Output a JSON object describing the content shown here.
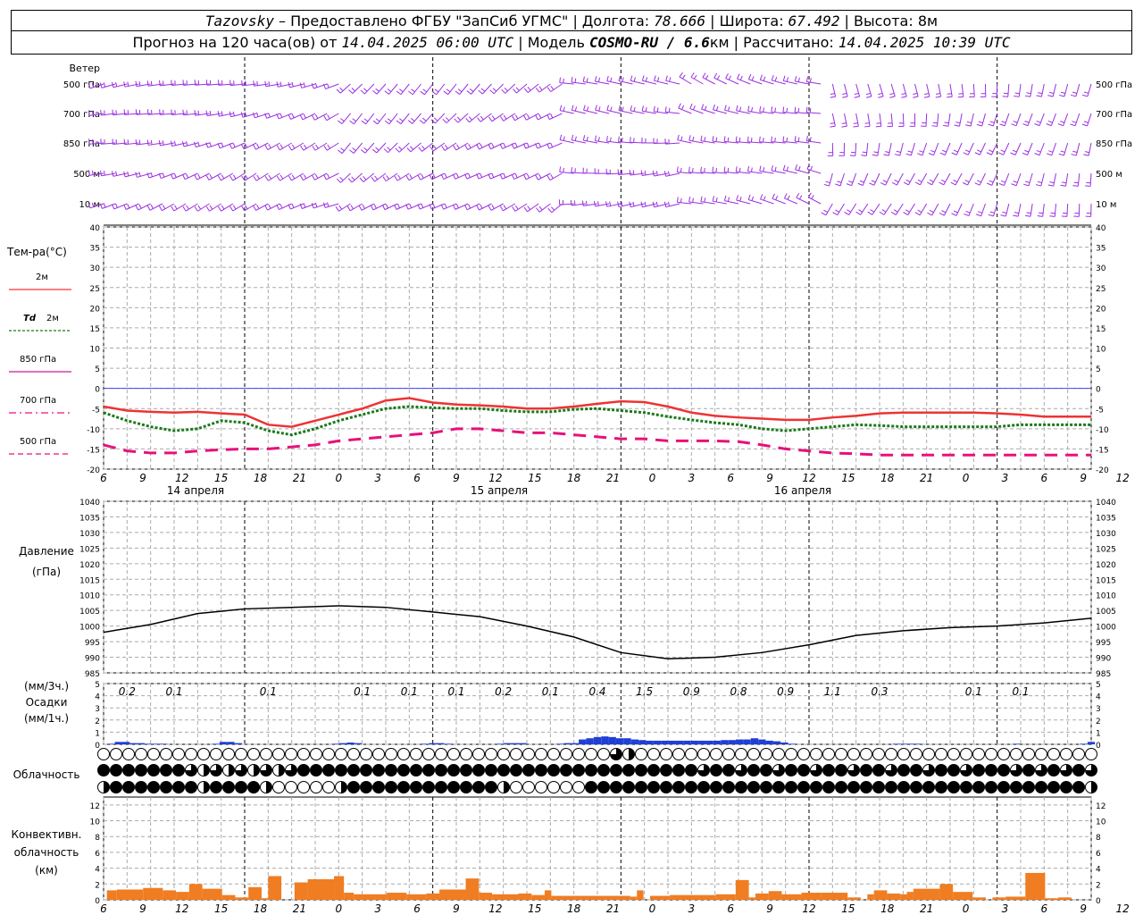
{
  "header": {
    "station": "Tazovsky",
    "provider": " – Предоставлено ФГБУ \"ЗапСиб УГМС\"",
    "lon_label": "Долгота:",
    "lon": "78.666",
    "lat_label": "Широта:",
    "lat": "67.492",
    "alt_label": "Высота:",
    "alt": "8м",
    "forecast_prefix": "Прогноз на 120 часа(ов) от",
    "forecast_start": "14.04.2025 06:00 UTC",
    "model_label": "Модель",
    "model": "COSMO-RU / 6.6",
    "model_unit": "км",
    "calc_label": "Рассчитано:",
    "calc_time": "14.04.2025 10:39 UTC"
  },
  "labels": {
    "wind": "Ветер",
    "wind_levels": [
      "500 гПа",
      "700 гПа",
      "850 гПа",
      "500 м",
      "10   м"
    ],
    "temp_title": "Тем-ра(°C)",
    "temp_legend": [
      {
        "prefix": "",
        "text": "2м",
        "color": "#ff3030",
        "dash": ""
      },
      {
        "prefix": "Td",
        "text": "2м",
        "color": "#1a7a1a",
        "dash": "3,2"
      },
      {
        "prefix": "",
        "text": "850 гПа",
        "color": "#cc1a9e",
        "dash": ""
      },
      {
        "prefix": "",
        "text": "700 гПа",
        "color": "#e8107a",
        "dash": "8,4,2,4"
      },
      {
        "prefix": "",
        "text": "500 гПа",
        "color": "#e8107a",
        "dash": "6,4"
      }
    ],
    "pressure_title": "Давление",
    "pressure_unit": "(гПа)",
    "precip_unit3": "(мм/3ч.)",
    "precip_title": "Осадки",
    "precip_unit1": "(мм/1ч.)",
    "cloud_title": "Облачность",
    "conv_title1": "Конвективн.",
    "conv_title2": "облачность",
    "conv_unit": "(км)"
  },
  "axis": {
    "hour_ticks": [
      "6",
      "9",
      "12",
      "15",
      "18",
      "21",
      "0",
      "3",
      "6",
      "9",
      "12",
      "15",
      "18",
      "21",
      "0",
      "3",
      "6",
      "9",
      "12",
      "15",
      "18",
      "21",
      "0",
      "3",
      "6",
      "9",
      "12"
    ],
    "days": [
      "14 апреля",
      "15 апреля",
      "16 апреля"
    ]
  },
  "chart_data": [
    {
      "type": "line",
      "name": "temperature",
      "x_hours_from_start": [
        0,
        3,
        6,
        9,
        12,
        15,
        18,
        21,
        24,
        27,
        30,
        33,
        36,
        39,
        42,
        45,
        48,
        51,
        54,
        57,
        60,
        63,
        66,
        69,
        72,
        75,
        78,
        81,
        84,
        87,
        90,
        93,
        96,
        99,
        102,
        105,
        108,
        111,
        114,
        117,
        120,
        123,
        126
      ],
      "ylim": [
        -20,
        40
      ],
      "yticks": [
        -20,
        -15,
        -10,
        -5,
        0,
        5,
        10,
        15,
        20,
        25,
        30,
        35,
        40
      ],
      "series": [
        {
          "name": "2м",
          "values": [
            -4.5,
            -5.5,
            -5.8,
            -6,
            -5.8,
            -6.2,
            -6.5,
            -9,
            -9.5,
            -8,
            -6.5,
            -5,
            -3,
            -2.4,
            -3.5,
            -4,
            -4.2,
            -4.5,
            -5,
            -5,
            -4.5,
            -3.8,
            -3.2,
            -3.4,
            -4.5,
            -6,
            -6.8,
            -7.2,
            -7.5,
            -7.8,
            -7.8,
            -7.2,
            -6.8,
            -6.2,
            -6.0,
            -6.0,
            -6.0,
            -6.0,
            -6.2,
            -6.5,
            -7,
            -7,
            -7
          ]
        },
        {
          "name": "Td 2м",
          "values": [
            -6,
            -8,
            -9.5,
            -10.5,
            -10,
            -8,
            -8.5,
            -10.5,
            -11.5,
            -10,
            -8,
            -6.5,
            -5,
            -4.5,
            -4.8,
            -5,
            -5,
            -5.5,
            -5.8,
            -5.8,
            -5.2,
            -5,
            -5.5,
            -6,
            -7,
            -7.8,
            -8.5,
            -9,
            -10,
            -10.5,
            -10,
            -9.5,
            -9,
            -9.2,
            -9.5,
            -9.5,
            -9.5,
            -9.5,
            -9.5,
            -9,
            -9,
            -9,
            -9
          ]
        },
        {
          "name": "500 гПа",
          "values": [
            -14,
            -15.5,
            -16,
            -16,
            -15.5,
            -15.2,
            -15,
            -15,
            -14.5,
            -14,
            -13,
            -12.5,
            -12,
            -11.5,
            -11,
            -10,
            -10,
            -10.5,
            -11,
            -11,
            -11.5,
            -12,
            -12.5,
            -12.5,
            -13,
            -13,
            -13,
            -13.2,
            -14,
            -15,
            -15.5,
            -16,
            -16.2,
            -16.5,
            -16.5,
            -16.5,
            -16.5,
            -16.5,
            -16.5,
            -16.5,
            -16.5,
            -16.5,
            -16.5
          ]
        }
      ]
    },
    {
      "type": "line",
      "name": "pressure",
      "x_hours_from_start": [
        0,
        6,
        12,
        18,
        24,
        30,
        36,
        42,
        48,
        54,
        60,
        66,
        72,
        78,
        84,
        90,
        96,
        102,
        108,
        114,
        120,
        126
      ],
      "ylim": [
        985,
        1040
      ],
      "yticks": [
        985,
        990,
        995,
        1000,
        1005,
        1010,
        1015,
        1020,
        1025,
        1030,
        1035,
        1040
      ],
      "values": [
        998,
        1000.5,
        1004,
        1005.5,
        1006,
        1006.5,
        1006,
        1004.5,
        1003,
        1000,
        996.5,
        991.5,
        989.5,
        990,
        991.5,
        994,
        997,
        998.5,
        999.5,
        1000,
        1001,
        1002.5
      ]
    },
    {
      "type": "bar",
      "name": "precipitation",
      "ylim": [
        0,
        5
      ],
      "yticks": [
        0,
        1,
        2,
        3,
        4,
        5
      ],
      "labels_3h": [
        {
          "hour": 3,
          "value": "0.2"
        },
        {
          "hour": 9,
          "value": "0.1"
        },
        {
          "hour": 21,
          "value": "0.1"
        },
        {
          "hour": 33,
          "value": "0.1"
        },
        {
          "hour": 39,
          "value": "0.1"
        },
        {
          "hour": 45,
          "value": "0.1"
        },
        {
          "hour": 51,
          "value": "0.2"
        },
        {
          "hour": 57,
          "value": "0.1"
        },
        {
          "hour": 63,
          "value": "0.4"
        },
        {
          "hour": 69,
          "value": "1.5"
        },
        {
          "hour": 75,
          "value": "0.9"
        },
        {
          "hour": 81,
          "value": "0.8"
        },
        {
          "hour": 87,
          "value": "0.9"
        },
        {
          "hour": 93,
          "value": "1.1"
        },
        {
          "hour": 99,
          "value": "0.3"
        },
        {
          "hour": 111,
          "value": "0.1"
        },
        {
          "hour": 117,
          "value": "0.1"
        }
      ],
      "hourly_mm": [
        0,
        0.05,
        0.2,
        0.2,
        0.1,
        0.1,
        0.05,
        0.05,
        0.05,
        0,
        0,
        0,
        0,
        0,
        0,
        0.05,
        0.2,
        0.2,
        0.1,
        0,
        0,
        0,
        0,
        0,
        0,
        0,
        0,
        0,
        0,
        0,
        0,
        0.05,
        0.1,
        0.15,
        0.1,
        0,
        0,
        0,
        0,
        0,
        0,
        0,
        0,
        0.05,
        0.1,
        0.1,
        0.05,
        0,
        0,
        0,
        0,
        0,
        0,
        0.05,
        0.1,
        0.1,
        0.1,
        0,
        0,
        0,
        0,
        0.05,
        0.1,
        0.1,
        0.4,
        0.5,
        0.6,
        0.65,
        0.6,
        0.5,
        0.5,
        0.4,
        0.35,
        0.3,
        0.3,
        0.3,
        0.3,
        0.3,
        0.3,
        0.3,
        0.3,
        0.3,
        0.3,
        0.35,
        0.35,
        0.4,
        0.4,
        0.5,
        0.4,
        0.3,
        0.25,
        0.15,
        0.05,
        0,
        0,
        0,
        0,
        0,
        0,
        0,
        0,
        0,
        0,
        0,
        0,
        0,
        0.05,
        0.05,
        0.05,
        0.05,
        0,
        0,
        0,
        0,
        0,
        0,
        0,
        0,
        0,
        0,
        0,
        0,
        0.05,
        0,
        0,
        0,
        0,
        0,
        0,
        0,
        0,
        0.05,
        0.2
      ]
    },
    {
      "type": "bar",
      "name": "convective_cloud",
      "ylim": [
        0,
        13
      ],
      "yticks": [
        0,
        2,
        4,
        6,
        8,
        10,
        12
      ],
      "bars": [
        {
          "start": 0.5,
          "end": 2,
          "top": 1.2
        },
        {
          "start": 2,
          "end": 6,
          "top": 1.3
        },
        {
          "start": 6,
          "end": 9,
          "top": 1.5
        },
        {
          "start": 9,
          "end": 11,
          "top": 1.2
        },
        {
          "start": 11,
          "end": 13,
          "top": 1.0
        },
        {
          "start": 13,
          "end": 15,
          "top": 2.0
        },
        {
          "start": 15,
          "end": 18,
          "top": 1.4
        },
        {
          "start": 18,
          "end": 20,
          "top": 0.6
        },
        {
          "start": 20,
          "end": 22,
          "top": 0.3
        },
        {
          "start": 22,
          "end": 24,
          "top": 1.6
        },
        {
          "start": 24,
          "end": 25,
          "top": 0.2
        },
        {
          "start": 25,
          "end": 27,
          "top": 3.0
        },
        {
          "start": 29,
          "end": 31,
          "top": 2.2
        },
        {
          "start": 31,
          "end": 35,
          "top": 2.6
        },
        {
          "start": 35,
          "end": 36.5,
          "top": 3.0
        },
        {
          "start": 36.5,
          "end": 38,
          "top": 0.9
        },
        {
          "start": 38,
          "end": 43,
          "top": 0.7
        },
        {
          "start": 43,
          "end": 46,
          "top": 0.9
        },
        {
          "start": 46,
          "end": 49,
          "top": 0.7
        },
        {
          "start": 49,
          "end": 51,
          "top": 0.8
        },
        {
          "start": 51,
          "end": 55,
          "top": 1.3
        },
        {
          "start": 55,
          "end": 57,
          "top": 2.7
        },
        {
          "start": 57,
          "end": 59,
          "top": 0.9
        },
        {
          "start": 59,
          "end": 63,
          "top": 0.7
        },
        {
          "start": 63,
          "end": 65,
          "top": 0.8
        },
        {
          "start": 65,
          "end": 67,
          "top": 0.6
        },
        {
          "start": 67,
          "end": 68,
          "top": 1.2
        },
        {
          "start": 68,
          "end": 80,
          "top": 0.5
        },
        {
          "start": 80,
          "end": 81,
          "top": 0.4
        },
        {
          "start": 81,
          "end": 82,
          "top": 1.2
        },
        {
          "start": 83,
          "end": 86,
          "top": 0.5
        },
        {
          "start": 86,
          "end": 93,
          "top": 0.6
        },
        {
          "start": 93,
          "end": 96,
          "top": 0.7
        },
        {
          "start": 96,
          "end": 98,
          "top": 2.5
        },
        {
          "start": 98,
          "end": 99,
          "top": 0.3
        },
        {
          "start": 99,
          "end": 101,
          "top": 0.8
        },
        {
          "start": 101,
          "end": 103,
          "top": 1.1
        },
        {
          "start": 103,
          "end": 106,
          "top": 0.7
        },
        {
          "start": 106,
          "end": 109,
          "top": 0.9
        },
        {
          "start": 109,
          "end": 113,
          "top": 0.9
        },
        {
          "start": 113,
          "end": 115,
          "top": 0.3
        },
        {
          "start": 116,
          "end": 117,
          "top": 0.7
        },
        {
          "start": 117,
          "end": 119,
          "top": 1.2
        },
        {
          "start": 119,
          "end": 121,
          "top": 0.8
        },
        {
          "start": 121,
          "end": 122,
          "top": 0.7
        },
        {
          "start": 122,
          "end": 123,
          "top": 1.0
        },
        {
          "start": 123,
          "end": 127,
          "top": 1.4
        },
        {
          "start": 127,
          "end": 129,
          "top": 2.0
        },
        {
          "start": 129,
          "end": 132,
          "top": 1.0
        },
        {
          "start": 132,
          "end": 134,
          "top": 0.3
        },
        {
          "start": 135,
          "end": 137,
          "top": 0.3
        },
        {
          "start": 137,
          "end": 140,
          "top": 0.4
        },
        {
          "start": 140,
          "end": 143,
          "top": 3.4
        },
        {
          "start": 143,
          "end": 145,
          "top": 0.2
        },
        {
          "start": 145,
          "end": 147,
          "top": 0.3
        }
      ]
    }
  ],
  "colors": {
    "wind": "#9a30e0",
    "precip": "#1f3fd6",
    "conv": "#f07d22",
    "zero_line": "#4040ff"
  }
}
